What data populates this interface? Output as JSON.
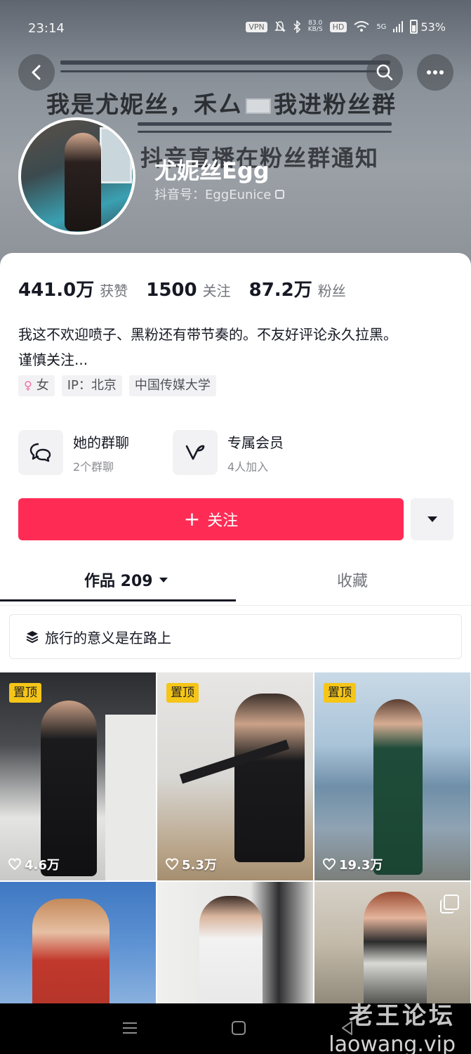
{
  "status_bar": {
    "time": "23:14",
    "vpn": "VPN",
    "net_speed_value": "83.0",
    "net_speed_unit": "KB/S",
    "hd": "HD",
    "signal": "5G",
    "battery": "53%"
  },
  "banner": {
    "line1_left": "我是尤妮丝，禾厶",
    "line1_right": "我进粉丝群",
    "line2": "抖音直播在粉丝群通知"
  },
  "profile": {
    "name": "尤妮丝Egg",
    "douyin_id": "抖音号：EggEunice"
  },
  "stats": [
    {
      "value": "441.0万",
      "label": "获赞"
    },
    {
      "value": "1500",
      "label": "关注"
    },
    {
      "value": "87.2万",
      "label": "粉丝"
    }
  ],
  "bio": {
    "line1": "我这不欢迎喷子、黑粉还有带节奏的。不友好评论永久拉黑。",
    "line2": "谨慎关注..."
  },
  "tags": {
    "gender": "女",
    "ip": "IP：北京",
    "school": "中国传媒大学"
  },
  "features": [
    {
      "title": "她的群聊",
      "subtitle": "2个群聊"
    },
    {
      "title": "专属会员",
      "subtitle": "4人加入"
    }
  ],
  "follow": {
    "plus": "+",
    "label": "关注"
  },
  "tabs": {
    "works": "作品 209",
    "favorites": "收藏"
  },
  "collection": {
    "label": "旅行的意义是在路上"
  },
  "videos": [
    {
      "pinned": "置顶",
      "likes": "4.6万"
    },
    {
      "pinned": "置顶",
      "likes": "5.3万"
    },
    {
      "pinned": "置顶",
      "likes": "19.3万"
    }
  ],
  "watermark": {
    "line1": "老王论坛",
    "line2": "laowang.vip"
  },
  "colors": {
    "accent": "#fe2c55",
    "pin_badge": "#f5c518"
  }
}
